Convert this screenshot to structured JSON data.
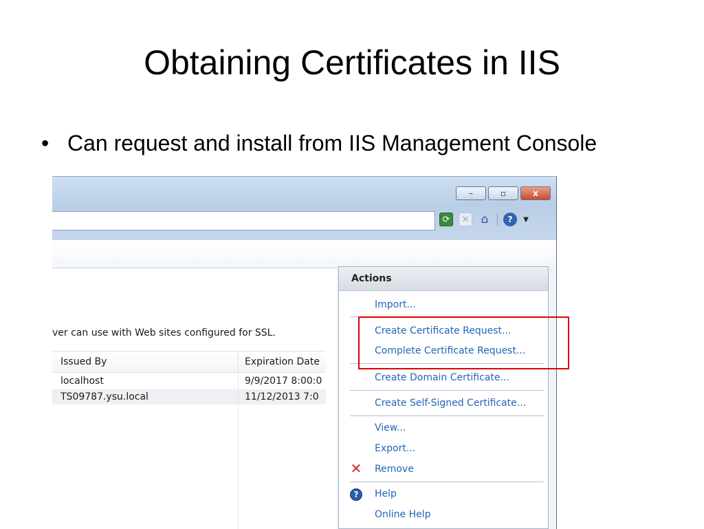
{
  "slide": {
    "title": "Obtaining Certificates in IIS",
    "bullet": "Can request and install from IIS Management Console"
  },
  "window": {
    "controls": {
      "minimize": "–",
      "maximize": "▫",
      "close": "x"
    },
    "nav_icons": [
      "refresh-icon",
      "stop-icon",
      "home-icon",
      "help-icon",
      "dropdown-arrow-icon"
    ]
  },
  "content": {
    "description": "ver can use with Web sites configured for SSL.",
    "columns": {
      "issued_by": "Issued By",
      "expiration": "Expiration Date"
    },
    "rows": [
      {
        "issued_by": "localhost",
        "expiration": "9/9/2017 8:00:0"
      },
      {
        "issued_by": "TS09787.ysu.local",
        "expiration": "11/12/2013 7:0"
      }
    ]
  },
  "actions": {
    "title": "Actions",
    "import": "Import...",
    "create_request": "Create Certificate Request...",
    "complete_request": "Complete Certificate Request...",
    "create_domain": "Create Domain Certificate...",
    "create_self_signed": "Create Self-Signed Certificate...",
    "view": "View...",
    "export": "Export...",
    "remove": "Remove",
    "help": "Help",
    "online_help": "Online Help"
  },
  "colors": {
    "highlight": "#e00000",
    "link": "#2165b7"
  }
}
